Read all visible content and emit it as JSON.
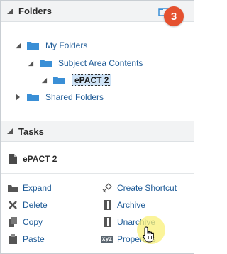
{
  "folders_panel": {
    "title": "Folders",
    "step_badge": "3",
    "tree": {
      "my_folders": "My Folders",
      "subject_area_contents": "Subject Area Contents",
      "selected_item": "ePACT 2",
      "shared_folders": "Shared Folders"
    }
  },
  "tasks_panel": {
    "title": "Tasks",
    "selected_object": "ePACT 2",
    "actions": {
      "expand": "Expand",
      "create_shortcut": "Create Shortcut",
      "delete": "Delete",
      "archive": "Archive",
      "copy": "Copy",
      "unarchive": "Unarchive",
      "paste": "Paste",
      "properties": "Properties",
      "properties_icon_text": "xyz"
    }
  },
  "colors": {
    "link": "#1d5a96",
    "folder": "#3a8fd6",
    "badge": "#e5512f",
    "selection": "#cfe3f6",
    "cursor_highlight": "#faf078"
  }
}
